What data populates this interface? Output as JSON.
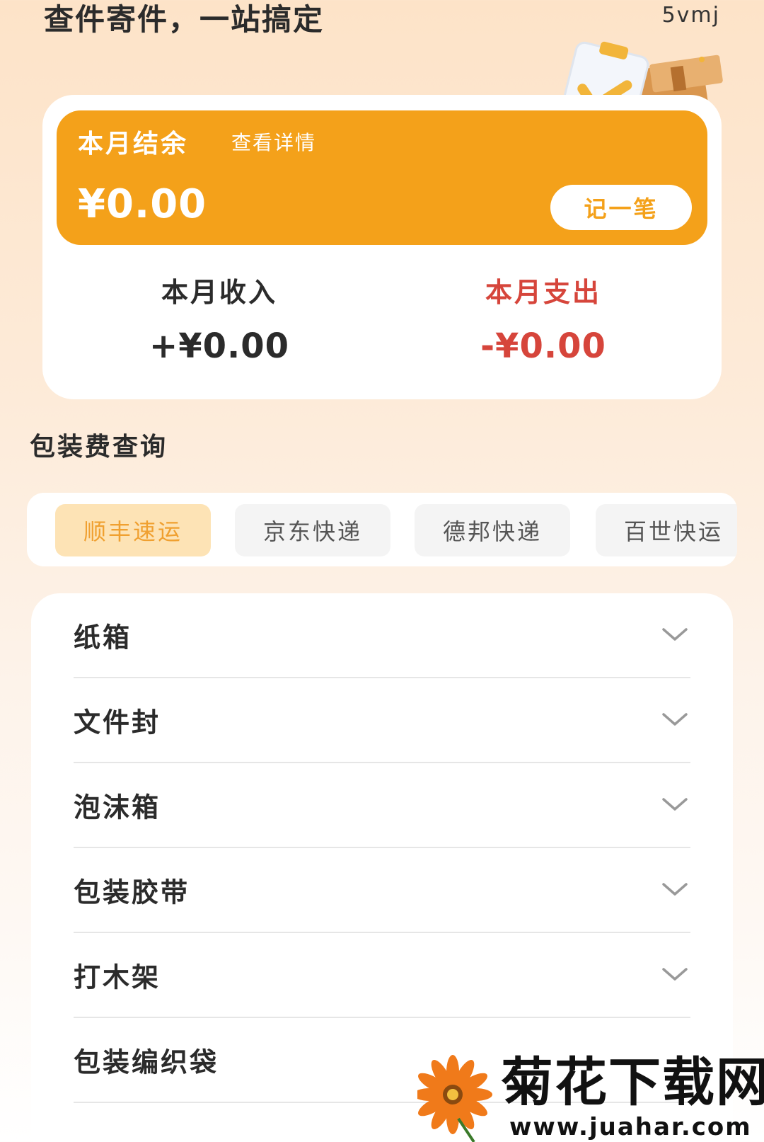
{
  "header": {
    "title": "查件寄件，一站搞定",
    "user": "5vmj"
  },
  "summary": {
    "balance_label": "本月结余",
    "detail_link": "查看详情",
    "balance_amount": "¥0.00",
    "record_button": "记一笔",
    "income_label": "本月收入",
    "income_value": "+¥0.00",
    "expense_label": "本月支出",
    "expense_value": "-¥0.00"
  },
  "packaging": {
    "section_title": "包装费查询",
    "tabs": [
      {
        "label": "顺丰速运",
        "active": true
      },
      {
        "label": "京东快递",
        "active": false
      },
      {
        "label": "德邦快递",
        "active": false
      },
      {
        "label": "百世快运",
        "active": false
      }
    ],
    "items": [
      {
        "label": "纸箱"
      },
      {
        "label": "文件封"
      },
      {
        "label": "泡沫箱"
      },
      {
        "label": "包装胶带"
      },
      {
        "label": "打木架"
      },
      {
        "label": "包装编织袋"
      }
    ]
  },
  "watermark": {
    "title": "菊花下载网",
    "url": "www.juahar.com"
  },
  "colors": {
    "accent": "#f4a11a",
    "expense": "#d6453b",
    "active_tab_bg": "#fde3b5"
  }
}
